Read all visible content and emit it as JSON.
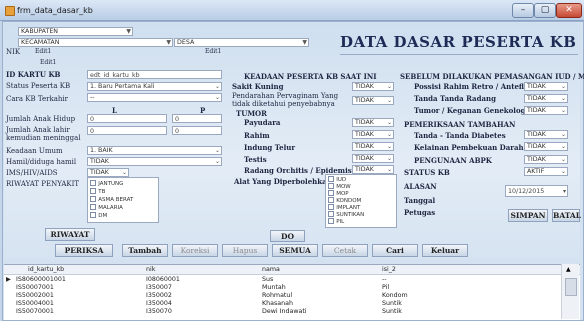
{
  "window": {
    "title": "frm_data_dasar_kb",
    "min": "–",
    "max": "▢",
    "close": "✕"
  },
  "top": {
    "kabupaten_label": "KABUPATEN",
    "kecamatan_label": "KECAMATAN",
    "desa_label": "DESA",
    "nik_label": "NIK",
    "edit1a": "Edit1",
    "edit1b": "Edit1",
    "edit1c": "Edit1"
  },
  "heading": "DATA DASAR PESERTA KB",
  "left": {
    "id_label": "ID KARTU KB",
    "id_value": "edt_id_kartu_kb",
    "status_label": "Status Peserta KB",
    "status_value": "1. Baru Pertama Kali",
    "cara_label": "Cara KB Terkahir",
    "cara_value": "--",
    "col_L": "L",
    "col_P": "P",
    "hidup_label": "Jumlah Anak Hidup",
    "hidup_L": "0",
    "hidup_P": "0",
    "lahir_label1": "Jumlah Anak lahir",
    "lahir_label2": "kemudian meninggal",
    "lahir_L": "0",
    "lahir_P": "0",
    "keadaan_label": "Keadaan Umum",
    "keadaan_value": "1. BAIK",
    "hamil_label": "Hamil/diduga hamil",
    "hamil_value": "TIDAK",
    "ims_label": "IMS/HIV/AIDS",
    "ims_value": "TIDAK",
    "riwayat_label": "RIWAYAT PENYAKIT",
    "penyakit": [
      "JANTUNG",
      "TB",
      "ASMA BERAT",
      "MALARIA",
      "DM"
    ]
  },
  "middle": {
    "title": "KEADAAN PESERTA KB SAAT INI",
    "sakit_kuning": "Sakit Kuning",
    "sakit_kuning_val": "TIDAK",
    "pendarahan1": "Pendarahan Pervaginam Yang",
    "pendarahan2": "tidak diketahui penyebabnya",
    "pendarahan_val": "TIDAK",
    "tumor": "TUMOR",
    "payudara": "Payudara",
    "payudara_val": "TIDAK",
    "rahim": "Rahim",
    "rahim_val": "TIDAK",
    "indung": "Indung Telur",
    "indung_val": "TIDAK",
    "testis": "Testis",
    "testis_val": "TIDAK",
    "radang": "Radang Orchitis / Epidemistis",
    "radang_val": "TIDAK",
    "alat": "Alat Yang Diperbolehkan",
    "alat_list": [
      "IUD",
      "MOW",
      "MOP",
      "KONDOM",
      "IMPLANT",
      "SUNTIKAN",
      "PIL"
    ]
  },
  "right": {
    "title": "SEBELUM DILAKUKAN PEMASANGAN IUD / MOW",
    "posisi": "Possisi Rahim Retro / Antefleksi",
    "posisi_val": "TIDAK",
    "radang": "Tanda Tanda Radang",
    "radang_val": "TIDAK",
    "tumor": "Tumor / Keganan Genekologi",
    "tumor_val": "TIDAK",
    "pemeriksaan": "PEMERIKSAAN TAMBAHAN",
    "diabetes": "Tanda - Tanda Diabetes",
    "diabetes_val": "TIDAK",
    "kelainan": "Kelainan Pembekuan Darah",
    "kelainan_val": "TIDAK",
    "penguunaan": "PENGUNAAN ABPK",
    "penguunaan_val": "TIDAK",
    "status_kb": "STATUS KB",
    "status_kb_val": "AKTIF",
    "alasan": "ALASAN",
    "tanggal": "Tanggal",
    "tanggal_val": "10/12/2015",
    "petugas": "Petugas",
    "simpan": "SIMPAN",
    "batal": "BATAL"
  },
  "buttons": {
    "riwayat": "RIWAYAT",
    "do": "DO",
    "periksa": "PERIKSA",
    "tambah": "Tambah",
    "koreksi": "Koreksi",
    "hapus": "Hapus",
    "semua": "SEMUA",
    "cetak": "Cetak",
    "cari": "Cari",
    "keluar": "Keluar"
  },
  "grid": {
    "columns": [
      "id_kartu_kb",
      "nik",
      "nama",
      "isi_2"
    ],
    "rows": [
      [
        "IS80600001001",
        "I08060001",
        "Sus",
        "--"
      ],
      [
        "IS50007001",
        "I350007",
        "Muntah",
        "Pil"
      ],
      [
        "IS50002001",
        "I350002",
        "Rohmatul",
        "Kondom"
      ],
      [
        "IS50004001",
        "I350004",
        "Khasanah",
        "Suntik"
      ],
      [
        "IS50070001",
        "I350070",
        "Dewi Indawati",
        "Suntik"
      ]
    ],
    "current_marker": "▶"
  }
}
